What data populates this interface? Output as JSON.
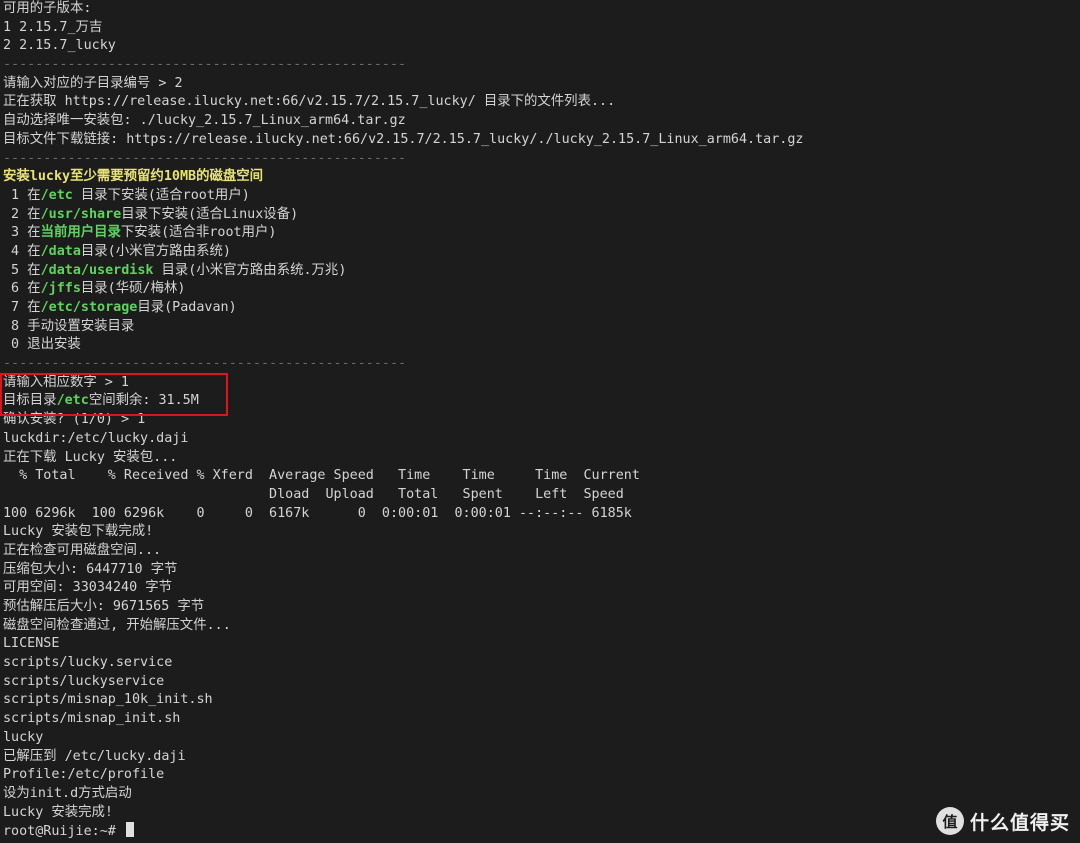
{
  "terminal": {
    "l00": "可用的子版本:",
    "l01": "1 2.15.7_万吉",
    "l02": "2 2.15.7_lucky",
    "sep": "--------------------------------------------------",
    "l04": "请输入对应的子目录编号 > 2",
    "l05": "正在获取 https://release.ilucky.net:66/v2.15.7/2.15.7_lucky/ 目录下的文件列表...",
    "l06": "自动选择唯一安装包: ./lucky_2.15.7_Linux_arm64.tar.gz",
    "l07": "目标文件下载链接: https://release.ilucky.net:66/v2.15.7/2.15.7_lucky/./lucky_2.15.7_Linux_arm64.tar.gz",
    "l09": "安装lucky至少需要预留约10MB的磁盘空间",
    "opt1": [
      " 1 在",
      "/etc",
      " 目录下安装(适合root用户)"
    ],
    "opt2": [
      " 2 在",
      "/usr/share",
      "目录下安装(适合Linux设备)"
    ],
    "opt3": [
      " 3 在",
      "当前用户目录",
      "下安装(适合非root用户)"
    ],
    "opt4": [
      " 4 在",
      "/data",
      "目录(小米官方路由系统)"
    ],
    "opt5": [
      " 5 在",
      "/data/userdisk",
      " 目录(小米官方路由系统.万兆)"
    ],
    "opt6": [
      " 6 在",
      "/jffs",
      "目录(华硕/梅林)"
    ],
    "opt7": [
      " 7 在",
      "/etc/storage",
      "目录(Padavan)"
    ],
    "l17": " 8 手动设置安装目录",
    "l18": " 0 退出安装",
    "l20": "请输入相应数字 > 1",
    "l21": [
      "目标目录",
      "/etc",
      "空间剩余: 31.5M"
    ],
    "l22": "确认安装? (1/0) > 1",
    "l23": "luckdir:/etc/lucky.daji",
    "l24": "正在下载 Lucky 安装包...",
    "l25": "  % Total    % Received % Xferd  Average Speed   Time    Time     Time  Current",
    "l26": "                                 Dload  Upload   Total   Spent    Left  Speed",
    "l27": "100 6296k  100 6296k    0     0  6167k      0  0:00:01  0:00:01 --:--:-- 6185k",
    "l28": "Lucky 安装包下载完成!",
    "l29": "正在检查可用磁盘空间...",
    "l30": "压缩包大小: 6447710 字节",
    "l31": "可用空间: 33034240 字节",
    "l32": "预估解压后大小: 9671565 字节",
    "l33": "磁盘空间检查通过, 开始解压文件...",
    "l34": "LICENSE",
    "l35": "scripts/lucky.service",
    "l36": "scripts/luckyservice",
    "l37": "scripts/misnap_10k_init.sh",
    "l38": "scripts/misnap_init.sh",
    "l39": "lucky",
    "l40": "已解压到 /etc/lucky.daji",
    "l41": "Profile:/etc/profile",
    "l42": "设为init.d方式启动",
    "l43": "Lucky 安装完成!",
    "prompt": "root@Ruijie:~#"
  },
  "colors": {
    "highlight_box": "#e1141c",
    "green": "#5fd35f",
    "yellow": "#e8e374"
  },
  "watermark": {
    "logo_icon": "值",
    "text": "什么值得买"
  }
}
